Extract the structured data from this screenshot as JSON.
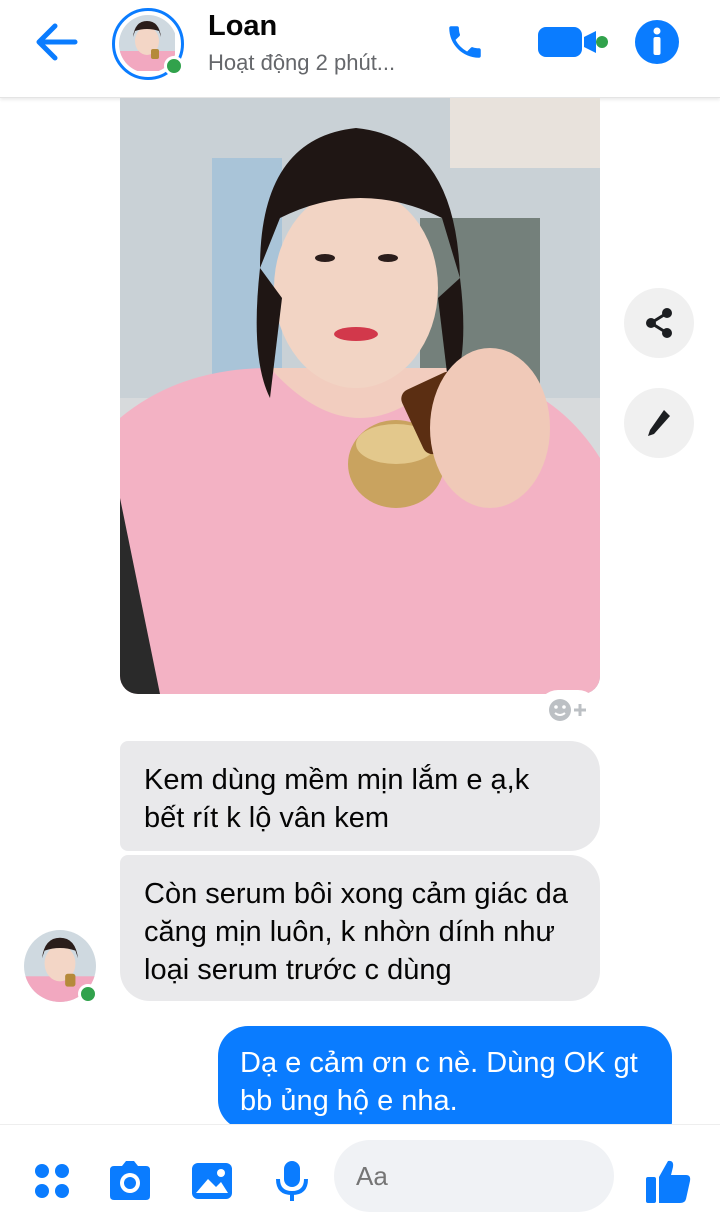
{
  "header": {
    "contact_name": "Loan",
    "status": "Hoạt động 2 phút..."
  },
  "messages": {
    "incoming_1": "Kem dùng mềm mịn lắm e ạ,k bết rít k lộ vân kem",
    "incoming_2": "Còn serum bôi xong cảm giác da căng mịn luôn, k nhờn dính như loại serum trước c dùng",
    "outgoing_1": "Dạ e cảm ơn c nè. Dùng OK gt bb ủng hộ e nha."
  },
  "composer": {
    "placeholder": "Aa"
  },
  "icons": {
    "back": "back-arrow-icon",
    "call": "phone-icon",
    "video": "video-camera-icon",
    "info": "info-icon",
    "share": "share-icon",
    "edit": "pencil-icon",
    "react": "add-reaction-icon",
    "menu": "four-dots-icon",
    "camera": "camera-icon",
    "gallery": "image-icon",
    "mic": "microphone-icon",
    "emoji": "emoji-icon",
    "like": "thumbs-up-icon"
  },
  "colors": {
    "accent": "#0a7cff",
    "online": "#31a24c",
    "incoming_bubble": "#e9e9eb"
  }
}
